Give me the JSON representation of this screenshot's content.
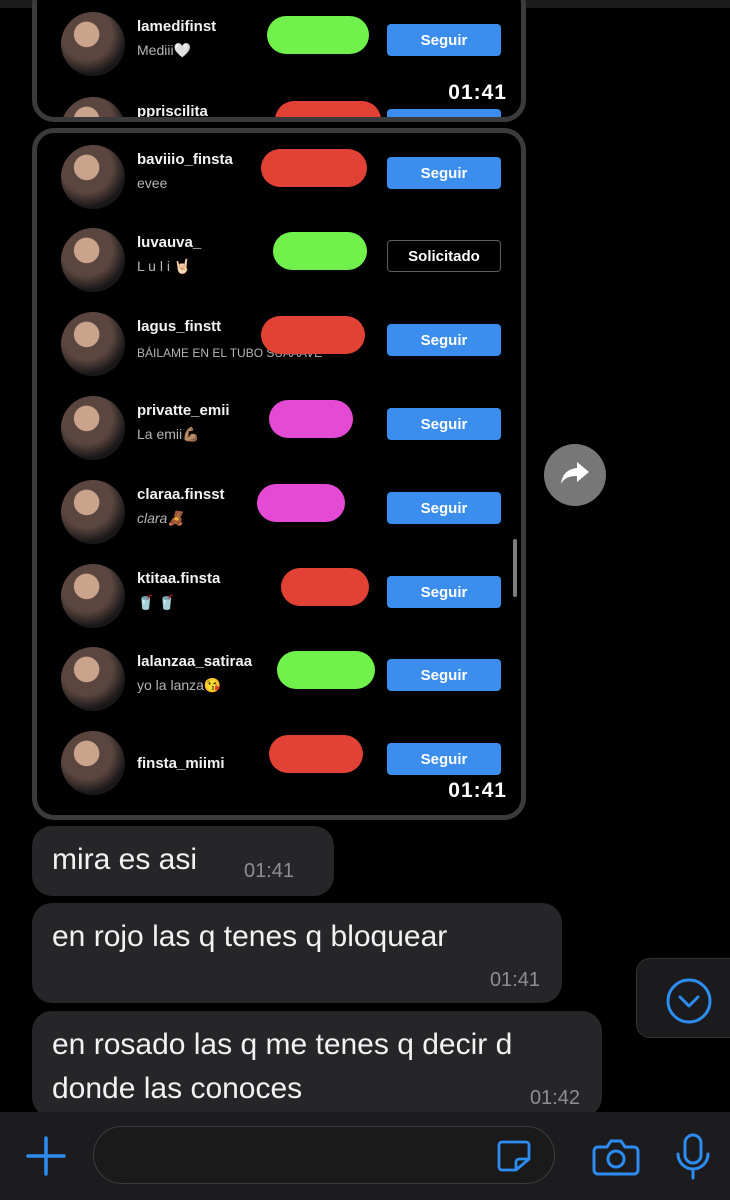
{
  "screenshot1": {
    "time": "01:41",
    "rows": [
      {
        "username": "lamedifinst",
        "subtitle": "Mediii🤍",
        "color": "green",
        "button": "Seguir"
      },
      {
        "username": "ppriscilita",
        "subtitle": "",
        "color": "red",
        "button": "Seguir"
      }
    ]
  },
  "screenshot2": {
    "time": "01:41",
    "rows": [
      {
        "username": "baviiio_finsta",
        "subtitle": "evee",
        "color": "red",
        "button": "Seguir"
      },
      {
        "username": "luvauva_",
        "subtitle": "L u l i 🤘🏻",
        "color": "green",
        "button": "Solicitado"
      },
      {
        "username": "lagus_finstt",
        "subtitle": "BÁILAME EN EL TUBO SUAAAVE",
        "color": "red",
        "button": "Seguir"
      },
      {
        "username": "privatte_emii",
        "subtitle": "La emii💪🏽",
        "color": "pink",
        "button": "Seguir"
      },
      {
        "username": "claraa.finsst",
        "subtitle": "clara🧸",
        "color": "pink",
        "button": "Seguir"
      },
      {
        "username": "ktitaa.finsta",
        "subtitle": "🥤 🥤",
        "color": "red",
        "button": "Seguir"
      },
      {
        "username": "lalanzaa_satiraa",
        "subtitle": "yo la lanza😘",
        "color": "green",
        "button": "Seguir"
      },
      {
        "username": "finsta_miimi",
        "subtitle": "",
        "color": "red",
        "button": "Seguir"
      }
    ]
  },
  "messages": [
    {
      "text": "mira es asi",
      "time": "01:41"
    },
    {
      "text": "en rojo las q tenes q bloquear",
      "time": "01:41"
    },
    {
      "text": "en rosado las q me tenes q decir d donde las conoces",
      "time": "01:42"
    }
  ],
  "colors": {
    "green": "#70f14b",
    "red": "#e24136",
    "pink": "#e54ad4",
    "follow_button": "#3b8eed",
    "message_bubble": "#262628",
    "accent_icons": "#2d8cf0"
  },
  "icons": {
    "share": "share-forward-icon",
    "scroll_down": "chevron-down-circle-icon",
    "attach": "plus-icon",
    "sticker": "sticker-icon",
    "camera": "camera-icon",
    "mic": "microphone-icon"
  }
}
